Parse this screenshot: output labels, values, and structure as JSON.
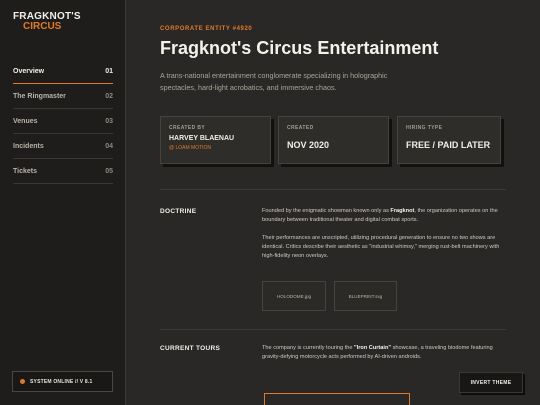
{
  "sidebar": {
    "brand_line1": "FRAGKNOT'S",
    "brand_line2": "CIRCUS",
    "items": [
      {
        "label": "Overview",
        "num": "01"
      },
      {
        "label": "The Ringmaster",
        "num": "02"
      },
      {
        "label": "Venues",
        "num": "03"
      },
      {
        "label": "Incidents",
        "num": "04"
      },
      {
        "label": "Tickets",
        "num": "05"
      }
    ],
    "active_index": 0,
    "status": "SYSTEM ONLINE // V 8.1"
  },
  "main": {
    "eyebrow": "CORPORATE ENTITY #4920",
    "title": "Fragknot's Circus Entertainment",
    "description": "A trans-national entertainment conglomerate specializing in holographic spectacles, hard-light acrobatics, and immersive chaos.",
    "cards": [
      {
        "label": "CREATED BY",
        "value": "HARVEY BLAENAU",
        "sub": "@ LOAM MOTION"
      },
      {
        "label": "CREATED",
        "value": "NOV 2020"
      },
      {
        "label": "HIRING TYPE",
        "value": "FREE / PAID LATER"
      }
    ],
    "doctrine": {
      "title": "DOCTRINE",
      "p1_before": "Founded by the enigmatic showman known only as ",
      "p1_bold": "Fragknot",
      "p1_after": ", the organization operates on the boundary between traditional theater and digital combat sports.",
      "p2": "Their performances are unscripted, utilizing procedural generation to ensure no two shows are identical. Critics describe their aesthetic as \"industrial whimsy,\" merging rust-belt machinery with high-fidelity neon overlays.",
      "assets": [
        "HOLODOME.jpg",
        "BLUEPRINT.svg"
      ]
    },
    "tours": {
      "title": "CURRENT TOURS",
      "p_before": "The company is currently touring the ",
      "p_bold": "\"Iron Curtain\"",
      "p_after": " showcase, a traveling biodome featuring gravity-defying motorcycle acts performed by AI-driven androids."
    }
  },
  "invert_button": "INVERT THEME",
  "colors": {
    "accent": "#e07a2a",
    "background": "#2a2826",
    "sidebar": "#1f1d1b"
  }
}
